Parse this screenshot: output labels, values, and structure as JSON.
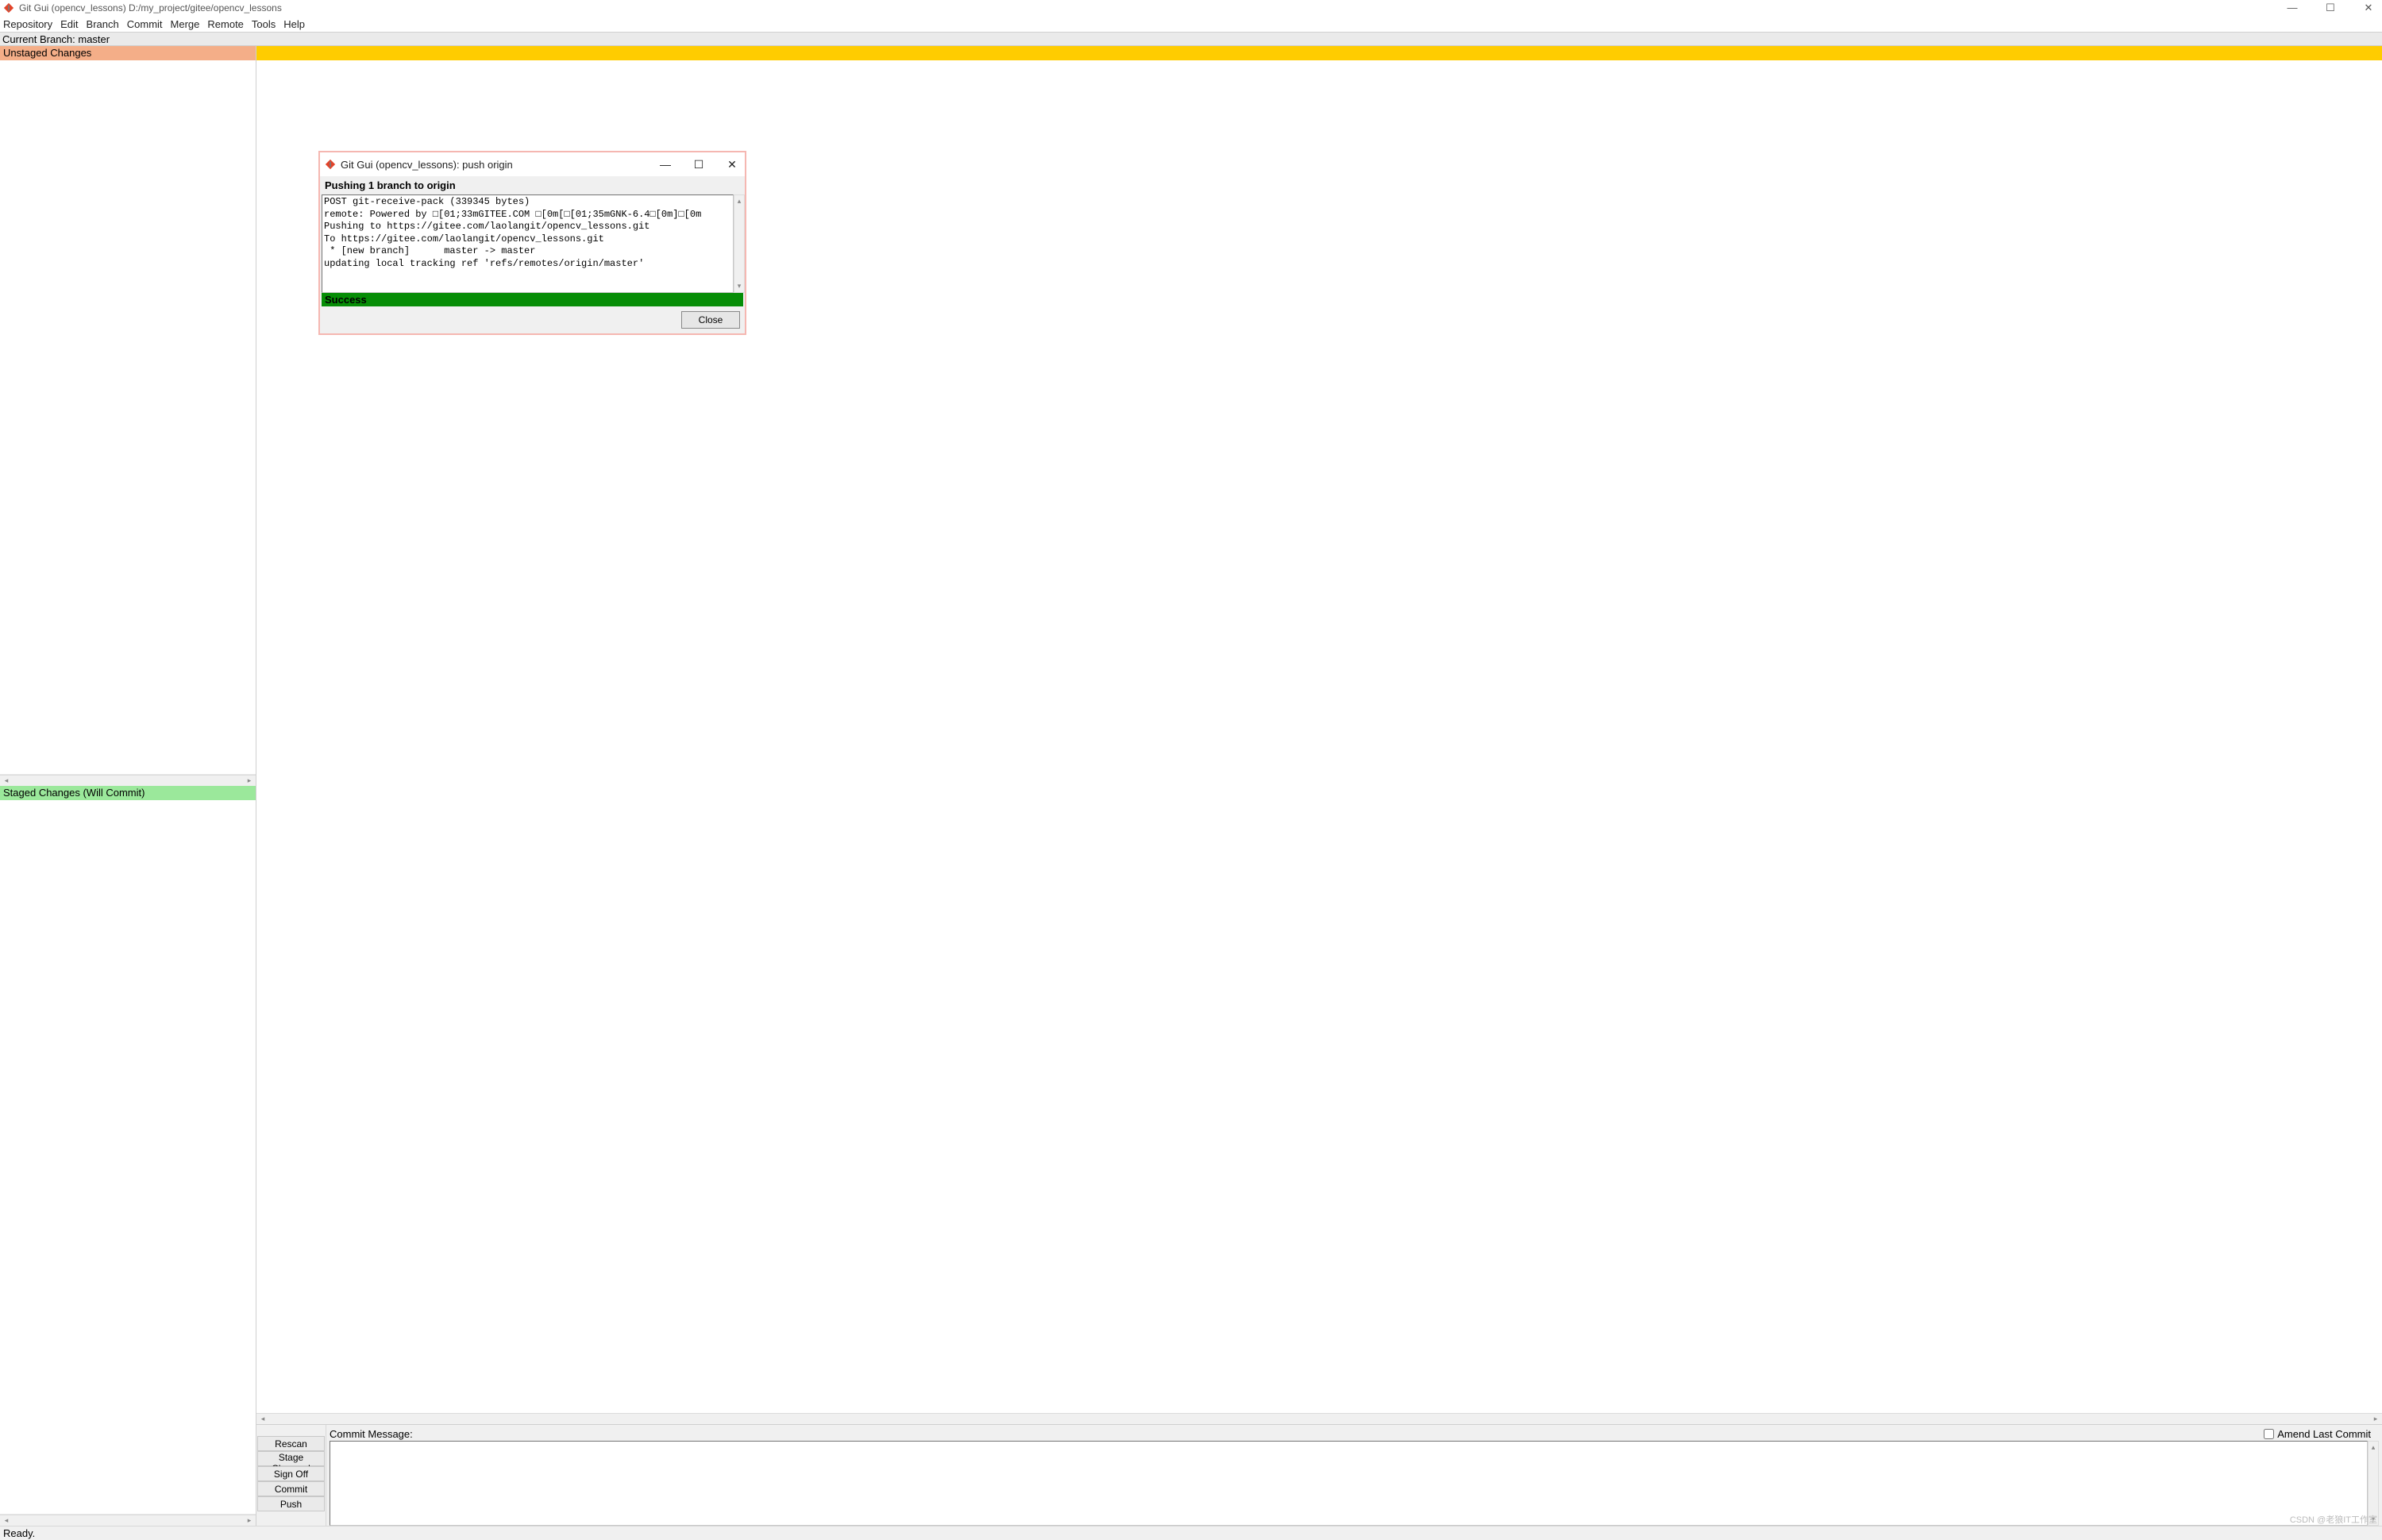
{
  "window": {
    "title": "Git Gui (opencv_lessons) D:/my_project/gitee/opencv_lessons"
  },
  "menu": {
    "repository": "Repository",
    "edit": "Edit",
    "branch": "Branch",
    "commit": "Commit",
    "merge": "Merge",
    "remote": "Remote",
    "tools": "Tools",
    "help": "Help"
  },
  "branchbar": "Current Branch: master",
  "left": {
    "unstaged": "Unstaged Changes",
    "staged": "Staged Changes (Will Commit)"
  },
  "commit": {
    "rescan": "Rescan",
    "stage_changed": "Stage Changed",
    "sign_off": "Sign Off",
    "commit": "Commit",
    "push": "Push",
    "msg_label": "Commit Message:",
    "amend_label": "Amend Last Commit",
    "msg_value": ""
  },
  "status": "Ready.",
  "dialog": {
    "title": "Git Gui (opencv_lessons): push origin",
    "subtitle": "Pushing 1 branch to origin",
    "output": "POST git-receive-pack (339345 bytes)\nremote: Powered by □[01;33mGITEE.COM □[0m[□[01;35mGNK-6.4□[0m]□[0m\nPushing to https://gitee.com/laolangit/opencv_lessons.git\nTo https://gitee.com/laolangit/opencv_lessons.git\n * [new branch]      master -> master\nupdating local tracking ref 'refs/remotes/origin/master'",
    "success": "Success",
    "close": "Close"
  },
  "watermark": "CSDN @老狼IT工作室"
}
